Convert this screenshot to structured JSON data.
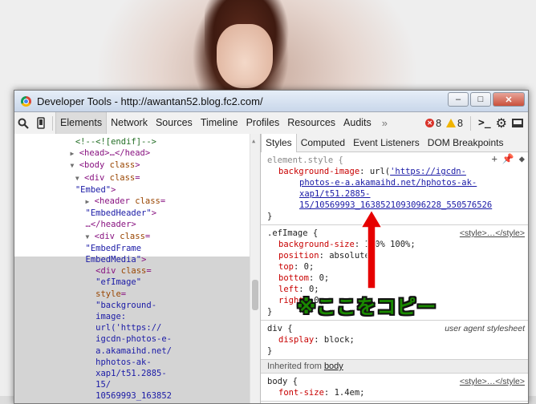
{
  "window": {
    "title": "Developer Tools - http://awantan52.blog.fc2.com/",
    "buttons": {
      "minimize": "–",
      "maximize": "□",
      "close": "✕"
    }
  },
  "toolbar": {
    "tabs": [
      "Elements",
      "Network",
      "Sources",
      "Timeline",
      "Profiles",
      "Resources",
      "Audits"
    ],
    "active_tab": "Elements",
    "more": "»",
    "error_count": "8",
    "warning_count": "8"
  },
  "dom_tree": [
    {
      "indent": 12,
      "comment": "<!--<![endif]-->"
    },
    {
      "indent": 11,
      "toggle": "closed",
      "text": "<head>…</head>"
    },
    {
      "indent": 11,
      "toggle": "open",
      "tag": "<body",
      "attr": " class",
      "end": ">"
    },
    {
      "indent": 12,
      "toggle": "open",
      "tag": "<div",
      "attr": " class",
      "eq": "="
    },
    {
      "indent": 12,
      "val": "\"Embed\"",
      "end": ">"
    },
    {
      "indent": 14,
      "toggle": "closed",
      "tag": "<header",
      "attr": " class",
      "eq": "="
    },
    {
      "indent": 14,
      "val": "\"EmbedHeader\"",
      "end": ">"
    },
    {
      "indent": 14,
      "text": "…</header>"
    },
    {
      "indent": 14,
      "toggle": "open",
      "tag": "<div",
      "attr": " class",
      "eq": "="
    },
    {
      "indent": 14,
      "val": "\"EmbedFrame"
    },
    {
      "indent": 14,
      "val": "EmbedMedia\"",
      "end": ">"
    },
    {
      "indent": 16,
      "tag": "<div",
      "attr": " class",
      "eq": "="
    },
    {
      "indent": 16,
      "val": "\"efImage\""
    },
    {
      "indent": 16,
      "attr": "style",
      "eq": "="
    },
    {
      "indent": 16,
      "val": "\"background-"
    },
    {
      "indent": 16,
      "val": "image:"
    },
    {
      "indent": 16,
      "val": "url('https://"
    },
    {
      "indent": 16,
      "val": "igcdn-photos-e-"
    },
    {
      "indent": 16,
      "val": "a.akamaihd.net/"
    },
    {
      "indent": 16,
      "val": "hphotos-ak-"
    },
    {
      "indent": 16,
      "val": "xap1/t51.2885-"
    },
    {
      "indent": 16,
      "val": "15/"
    },
    {
      "indent": 16,
      "val": "10569993_163852"
    }
  ],
  "styles": {
    "subtabs": [
      "Styles",
      "Computed",
      "Event Listeners",
      "DOM Breakpoints"
    ],
    "active_subtab": "Styles",
    "element_style": {
      "selector": "element.style {",
      "property": "background-image",
      "value_prefix": "url(",
      "url_lines": [
        "'https://igcdn-",
        "photos-e-a.akamaihd.net/hphotos-ak-",
        "xap1/t51.2885-",
        "15/10569993_1638521093096228_550576526"
      ],
      "close": "}"
    },
    "efimage_rule": {
      "selector": ".efImage {",
      "source": "<style>…</style>",
      "props": [
        {
          "name": "background-size",
          "value": "100% 100%;"
        },
        {
          "name": "position",
          "value": "absolute;"
        },
        {
          "name": "top",
          "value": "0;"
        },
        {
          "name": "bottom",
          "value": "0;"
        },
        {
          "name": "left",
          "value": "0;"
        },
        {
          "name": "right",
          "value": "0;"
        }
      ],
      "close": "}"
    },
    "div_rule": {
      "selector": "div {",
      "source": "user agent stylesheet",
      "prop_name": "display",
      "prop_value": "block;",
      "close": "}"
    },
    "inherited_label": "Inherited from",
    "inherited_from": "body",
    "body_rule": {
      "selector": "body {",
      "source": "<style>…</style>",
      "prop_name": "font-size",
      "prop_value": "1.4em;"
    }
  },
  "annotation": {
    "text": "※ここをコピー",
    "color": "#1a8a00",
    "arrow_color": "#e60000"
  }
}
